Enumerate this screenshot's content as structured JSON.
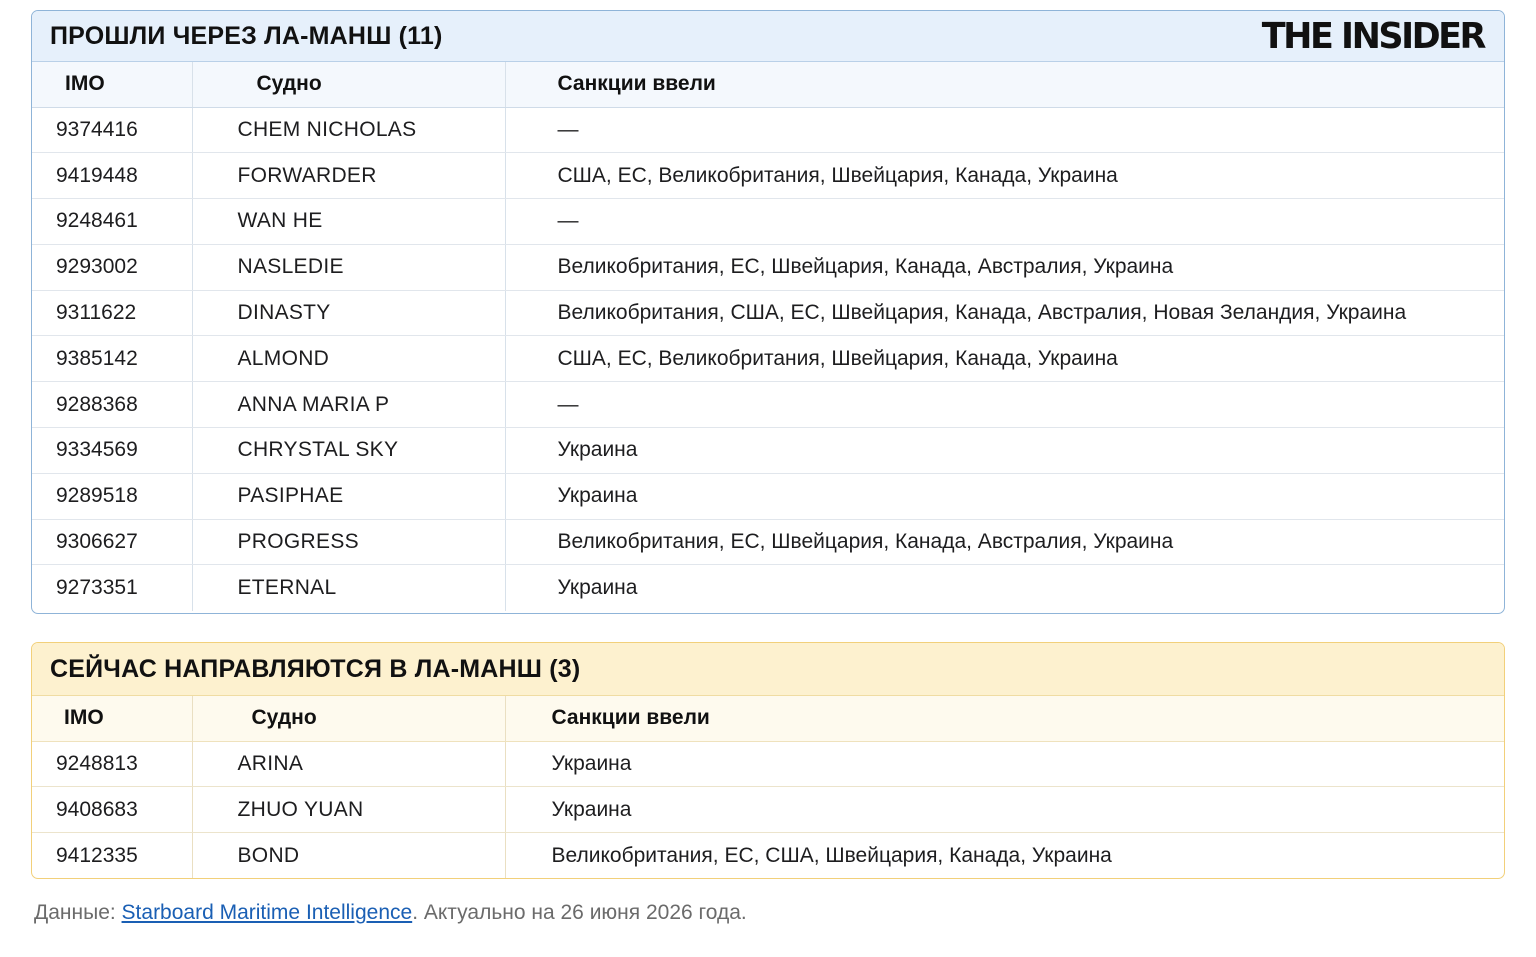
{
  "brand": {
    "logo_text": "THE INSIDER"
  },
  "passed": {
    "title": "ПРОШЛИ ЧЕРЕЗ ЛА-МАНШ (11)",
    "columns": [
      "IMO",
      "Судно",
      "Санкции ввели"
    ],
    "rows": [
      {
        "imo": "9374416",
        "ship": "CHEM NICHOLAS",
        "sanctions": "—"
      },
      {
        "imo": "9419448",
        "ship": "FORWARDER",
        "sanctions": "США, ЕС, Великобритания, Швейцария, Канада, Украина"
      },
      {
        "imo": "9248461",
        "ship": "WAN HE",
        "sanctions": "—"
      },
      {
        "imo": "9293002",
        "ship": "NASLEDIE",
        "sanctions": "Великобритания, ЕС, Швейцария, Канада, Австралия, Украина"
      },
      {
        "imo": "9311622",
        "ship": "DINASTY",
        "sanctions": "Великобритания, США, ЕС, Швейцария, Канада, Австралия, Новая Зеландия, Украина"
      },
      {
        "imo": "9385142",
        "ship": "ALMOND",
        "sanctions": "США, ЕС, Великобритания, Швейцария, Канада, Украина"
      },
      {
        "imo": "9288368",
        "ship": "ANNA MARIA P",
        "sanctions": "—"
      },
      {
        "imo": "9334569",
        "ship": "CHRYSTAL SKY",
        "sanctions": "Украина"
      },
      {
        "imo": "9289518",
        "ship": "PASIPHAE",
        "sanctions": "Украина"
      },
      {
        "imo": "9306627",
        "ship": "PROGRESS",
        "sanctions": "Великобритания, ЕС, Швейцария, Канада, Австралия, Украина"
      },
      {
        "imo": "9273351",
        "ship": "ETERNAL",
        "sanctions": "Украина"
      }
    ]
  },
  "heading": {
    "title": "СЕЙЧАС НАПРАВЛЯЮТСЯ В ЛА-МАНШ (3)",
    "columns": [
      "IMO",
      "Судно",
      "Санкции ввели"
    ],
    "rows": [
      {
        "imo": "9248813",
        "ship": "ARINA",
        "sanctions": "Украина"
      },
      {
        "imo": "9408683",
        "ship": "ZHUO YUAN",
        "sanctions": "Украина"
      },
      {
        "imo": "9412335",
        "ship": "BOND",
        "sanctions": "Великобритания, ЕС, США, Швейцария, Канада, Украина"
      }
    ]
  },
  "footer": {
    "prefix": "Данные: ",
    "source_link": "Starboard Maritime Intelligence",
    "suffix": ". Актуально на 26 июня 2026 года."
  },
  "colors": {
    "blue_panel_border": "#8fb4d8",
    "blue_header_bg": "#e6f0fb",
    "yellow_panel_border": "#f2d07a",
    "yellow_header_bg": "#fdf1cf",
    "link": "#1a5fb4"
  }
}
